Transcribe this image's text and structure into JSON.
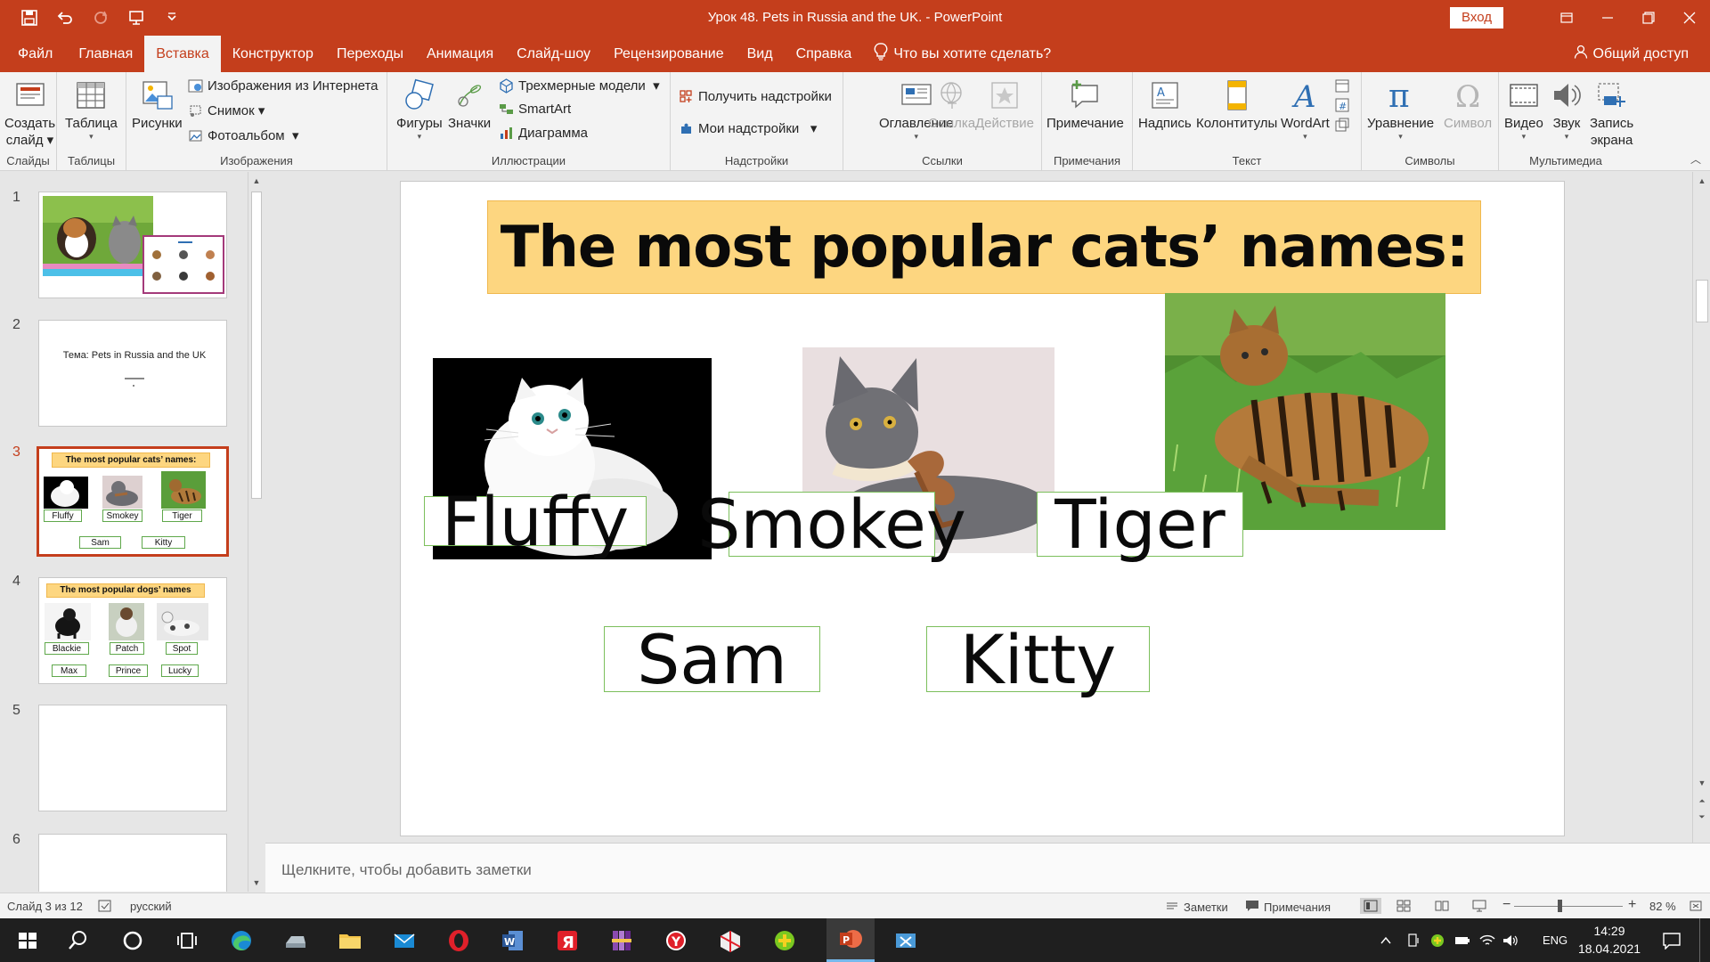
{
  "window": {
    "title": "Урок 48. Pets in Russia and the UK.  -  PowerPoint",
    "signin": "Вход"
  },
  "tabs": [
    "Файл",
    "Главная",
    "Вставка",
    "Конструктор",
    "Переходы",
    "Анимация",
    "Слайд-шоу",
    "Рецензирование",
    "Вид",
    "Справка"
  ],
  "active_tab": "Вставка",
  "tellme": "Что вы хотите сделать?",
  "share": "Общий доступ",
  "ribbon": {
    "slides": {
      "new_slide_line1": "Создать",
      "new_slide_line2": "слайд",
      "label": "Слайды"
    },
    "tables": {
      "table": "Таблица",
      "label": "Таблицы"
    },
    "images": {
      "pictures": "Рисунки",
      "online": "Изображения из Интернета",
      "screenshot": "Снимок",
      "album": "Фотоальбом",
      "label": "Изображения"
    },
    "illustrations": {
      "shapes": "Фигуры",
      "icons": "Значки",
      "models3d": "Трехмерные модели",
      "smartart": "SmartArt",
      "chart": "Диаграмма",
      "label": "Иллюстрации"
    },
    "addins": {
      "get": "Получить надстройки",
      "my": "Мои надстройки",
      "label": "Надстройки"
    },
    "links": {
      "toc": "Оглавление",
      "link": "Ссылка",
      "action": "Действие",
      "label": "Ссылки"
    },
    "comments": {
      "comment": "Примечание",
      "label": "Примечания"
    },
    "text": {
      "textbox": "Надпись",
      "headerfooter": "Колонтитулы",
      "wordart": "WordArt",
      "label": "Текст"
    },
    "symbols": {
      "equation": "Уравнение",
      "symbol": "Символ",
      "label": "Символы"
    },
    "media": {
      "video": "Видео",
      "audio": "Звук",
      "record_line1": "Запись",
      "record_line2": "экрана",
      "label": "Мультимедиа"
    }
  },
  "thumbnails": [
    {
      "num": "1"
    },
    {
      "num": "2",
      "text": "Тема: Pets in Russia and  the UK"
    },
    {
      "num": "3",
      "title": "The most popular cats’ names:",
      "names": [
        "Fluffy",
        "Smokey",
        "Tiger",
        "Sam",
        "Kitty"
      ]
    },
    {
      "num": "4",
      "title": "The most popular dogs’ names",
      "names": [
        "Blackie",
        "Patch",
        "Spot",
        "Max",
        "Prince",
        "Lucky"
      ]
    },
    {
      "num": "5"
    },
    {
      "num": "6"
    }
  ],
  "slide": {
    "title": "The most popular cats’ names:",
    "names": [
      "Fluffy",
      "Smokey",
      "Tiger",
      "Sam",
      "Kitty"
    ]
  },
  "notes_placeholder": "Щелкните, чтобы добавить заметки",
  "status": {
    "slide_info": "Слайд 3 из 12",
    "language": "русский",
    "notes": "Заметки",
    "comments": "Примечания",
    "zoom": "82 %"
  },
  "taskbar": {
    "lang": "ENG",
    "time": "14:29",
    "date": "18.04.2021"
  },
  "colors": {
    "accent": "#c43e1c",
    "banner": "#fdd680",
    "box_border": "#7cbf5c"
  }
}
